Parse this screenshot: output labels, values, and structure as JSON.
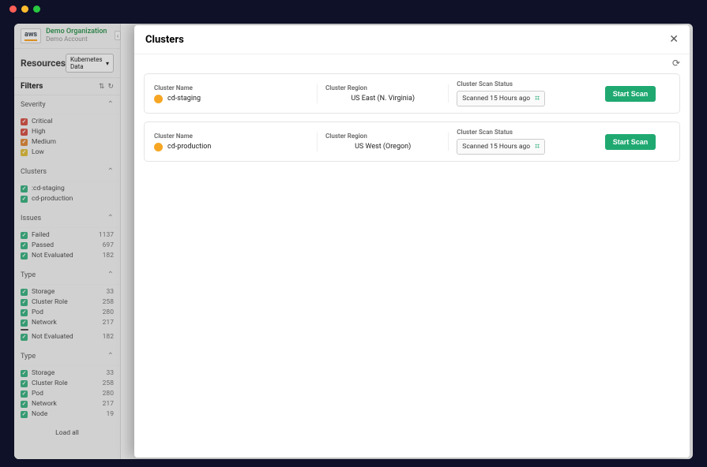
{
  "mac": {},
  "org": {
    "provider": "aws",
    "name": "Demo Organization",
    "account": "Demo Account"
  },
  "page_title": "Resources",
  "data_source_pill": "Kubernetes Data",
  "filters": {
    "title": "Filters",
    "groups": {
      "severity": {
        "label": "Severity",
        "items": [
          {
            "label": "Critical",
            "color": "red"
          },
          {
            "label": "High",
            "color": "red"
          },
          {
            "label": "Medium",
            "color": "orange"
          },
          {
            "label": "Low",
            "color": "yellow"
          }
        ]
      },
      "clusters": {
        "label": "Clusters",
        "items": [
          {
            "label": ":cd-staging"
          },
          {
            "label": "cd-production"
          }
        ]
      },
      "issues": {
        "label": "Issues",
        "items": [
          {
            "label": "Failed",
            "count": "1137"
          },
          {
            "label": "Passed",
            "count": "697"
          },
          {
            "label": "Not Evaluated",
            "count": "182"
          }
        ]
      },
      "type1": {
        "label": "Type",
        "items": [
          {
            "label": "Storage",
            "count": "33"
          },
          {
            "label": "Cluster Role",
            "count": "258"
          },
          {
            "label": "Pod",
            "count": "280"
          },
          {
            "label": "Network",
            "count": "217"
          },
          {
            "label": "Not Evaluated",
            "count": "182"
          }
        ]
      },
      "type2": {
        "label": "Type",
        "items": [
          {
            "label": "Storage",
            "count": "33"
          },
          {
            "label": "Cluster Role",
            "count": "258"
          },
          {
            "label": "Pod",
            "count": "280"
          },
          {
            "label": "Network",
            "count": "217"
          },
          {
            "label": "Node",
            "count": "19"
          }
        ]
      }
    },
    "load_all": "Load all"
  },
  "modal": {
    "title": "Clusters",
    "refresh_icon": "⟳",
    "columns": {
      "name": "Cluster Name",
      "region": "Cluster Region",
      "status": "Cluster Scan Status"
    },
    "rows": [
      {
        "name": "cd-staging",
        "region": "US East (N. Virginia)",
        "status": "Scanned 15 Hours ago",
        "action": "Start Scan"
      },
      {
        "name": "cd-production",
        "region": "US West (Oregon)",
        "status": "Scanned 15 Hours ago",
        "action": "Start Scan"
      }
    ]
  }
}
